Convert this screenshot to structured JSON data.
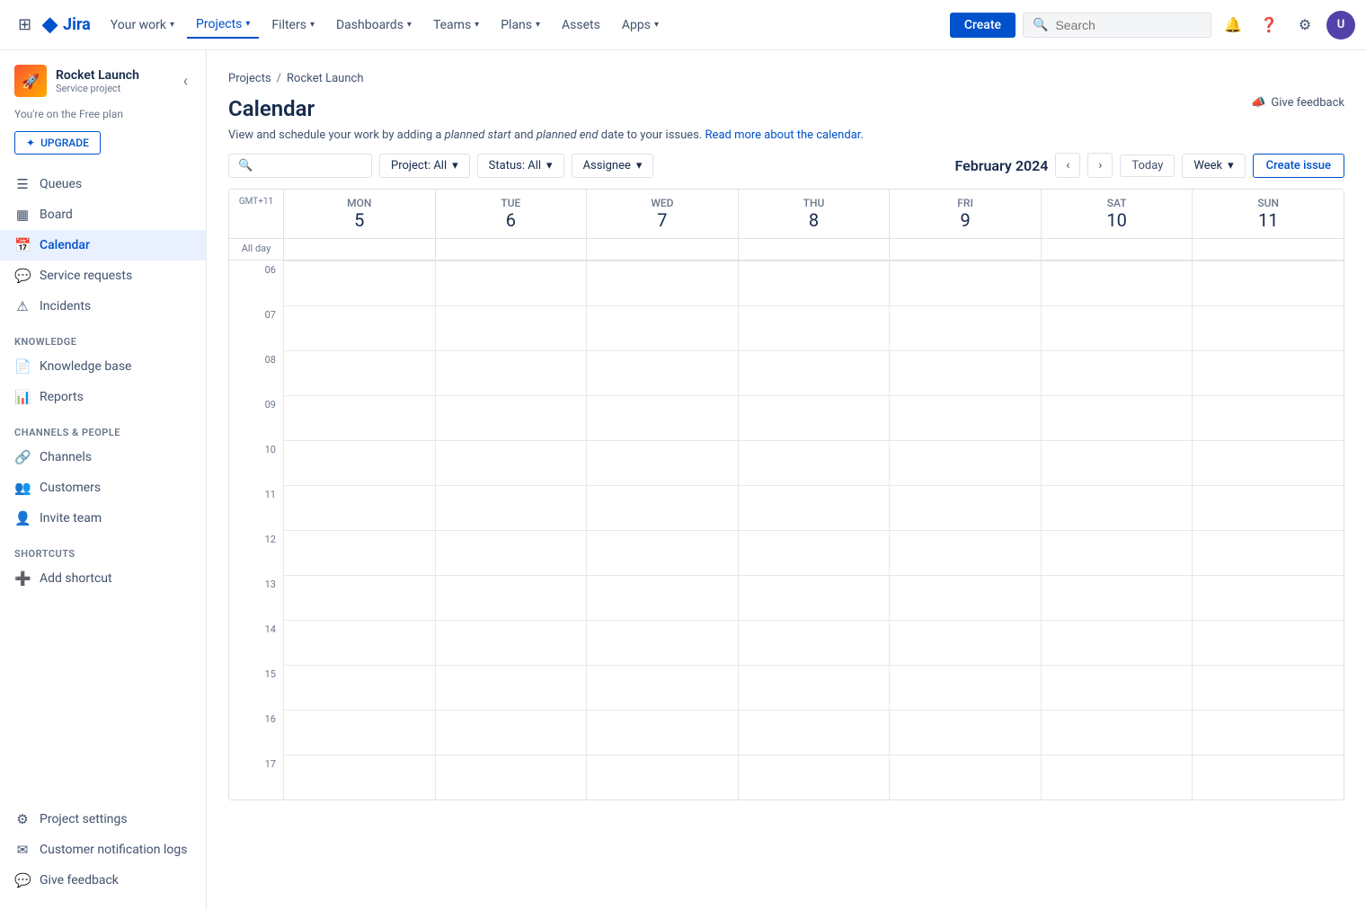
{
  "topnav": {
    "logo_text": "Jira",
    "items": [
      {
        "label": "Your work",
        "has_chevron": true,
        "active": false
      },
      {
        "label": "Projects",
        "has_chevron": true,
        "active": true
      },
      {
        "label": "Filters",
        "has_chevron": true,
        "active": false
      },
      {
        "label": "Dashboards",
        "has_chevron": true,
        "active": false
      },
      {
        "label": "Teams",
        "has_chevron": true,
        "active": false
      },
      {
        "label": "Plans",
        "has_chevron": true,
        "active": false
      },
      {
        "label": "Assets",
        "has_chevron": false,
        "active": false
      },
      {
        "label": "Apps",
        "has_chevron": true,
        "active": false
      }
    ],
    "create_label": "Create",
    "search_placeholder": "Search"
  },
  "sidebar": {
    "project_name": "Rocket Launch",
    "project_type": "Service project",
    "free_plan_text": "You're on the Free plan",
    "upgrade_label": "UPGRADE",
    "nav_items": [
      {
        "label": "Queues",
        "icon": "☰",
        "active": false
      },
      {
        "label": "Board",
        "icon": "▦",
        "active": false
      },
      {
        "label": "Calendar",
        "icon": "📅",
        "active": true
      },
      {
        "label": "Service requests",
        "icon": "💬",
        "active": false
      },
      {
        "label": "Incidents",
        "icon": "⚠",
        "active": false
      }
    ],
    "knowledge_label": "KNOWLEDGE",
    "knowledge_items": [
      {
        "label": "Knowledge base",
        "icon": "📄",
        "active": false
      },
      {
        "label": "Reports",
        "icon": "📊",
        "active": false
      }
    ],
    "channels_label": "CHANNELS & PEOPLE",
    "channels_items": [
      {
        "label": "Channels",
        "icon": "🔗",
        "active": false
      },
      {
        "label": "Customers",
        "icon": "👥",
        "active": false
      },
      {
        "label": "Invite team",
        "icon": "👤",
        "active": false
      }
    ],
    "shortcuts_label": "SHORTCUTS",
    "shortcuts_items": [
      {
        "label": "Add shortcut",
        "icon": "+",
        "active": false
      }
    ],
    "bottom_items": [
      {
        "label": "Project settings",
        "icon": "⚙",
        "active": false
      },
      {
        "label": "Customer notification logs",
        "icon": "✉",
        "active": false
      },
      {
        "label": "Give feedback",
        "icon": "💬",
        "active": false
      }
    ]
  },
  "breadcrumb": {
    "projects_label": "Projects",
    "separator": "/",
    "project_label": "Rocket Launch"
  },
  "page": {
    "title": "Calendar",
    "description_prefix": "View and schedule your work by adding a ",
    "planned_start": "planned start",
    "description_middle": " and ",
    "planned_end": "planned end",
    "description_suffix": " date to your issues. ",
    "read_more_link": "Read more about the calendar.",
    "give_feedback_label": "Give feedback"
  },
  "calendar_nav": {
    "month_year": "February 2024",
    "today_label": "Today"
  },
  "toolbar": {
    "project_filter_label": "Project: All",
    "status_filter_label": "Status: All",
    "assignee_filter_label": "Assignee",
    "week_label": "Week",
    "create_issue_label": "Create issue"
  },
  "calendar": {
    "gmt_label": "GMT+11",
    "allday_label": "All day",
    "days": [
      {
        "abbr": "MON",
        "num": "5"
      },
      {
        "abbr": "TUE",
        "num": "6"
      },
      {
        "abbr": "WED",
        "num": "7"
      },
      {
        "abbr": "THU",
        "num": "8"
      },
      {
        "abbr": "FRI",
        "num": "9"
      },
      {
        "abbr": "SAT",
        "num": "10"
      },
      {
        "abbr": "SUN",
        "num": "11"
      }
    ],
    "time_slots": [
      "06",
      "07",
      "08",
      "09",
      "10",
      "11",
      "12",
      "13",
      "14",
      "15",
      "16",
      "17"
    ]
  }
}
